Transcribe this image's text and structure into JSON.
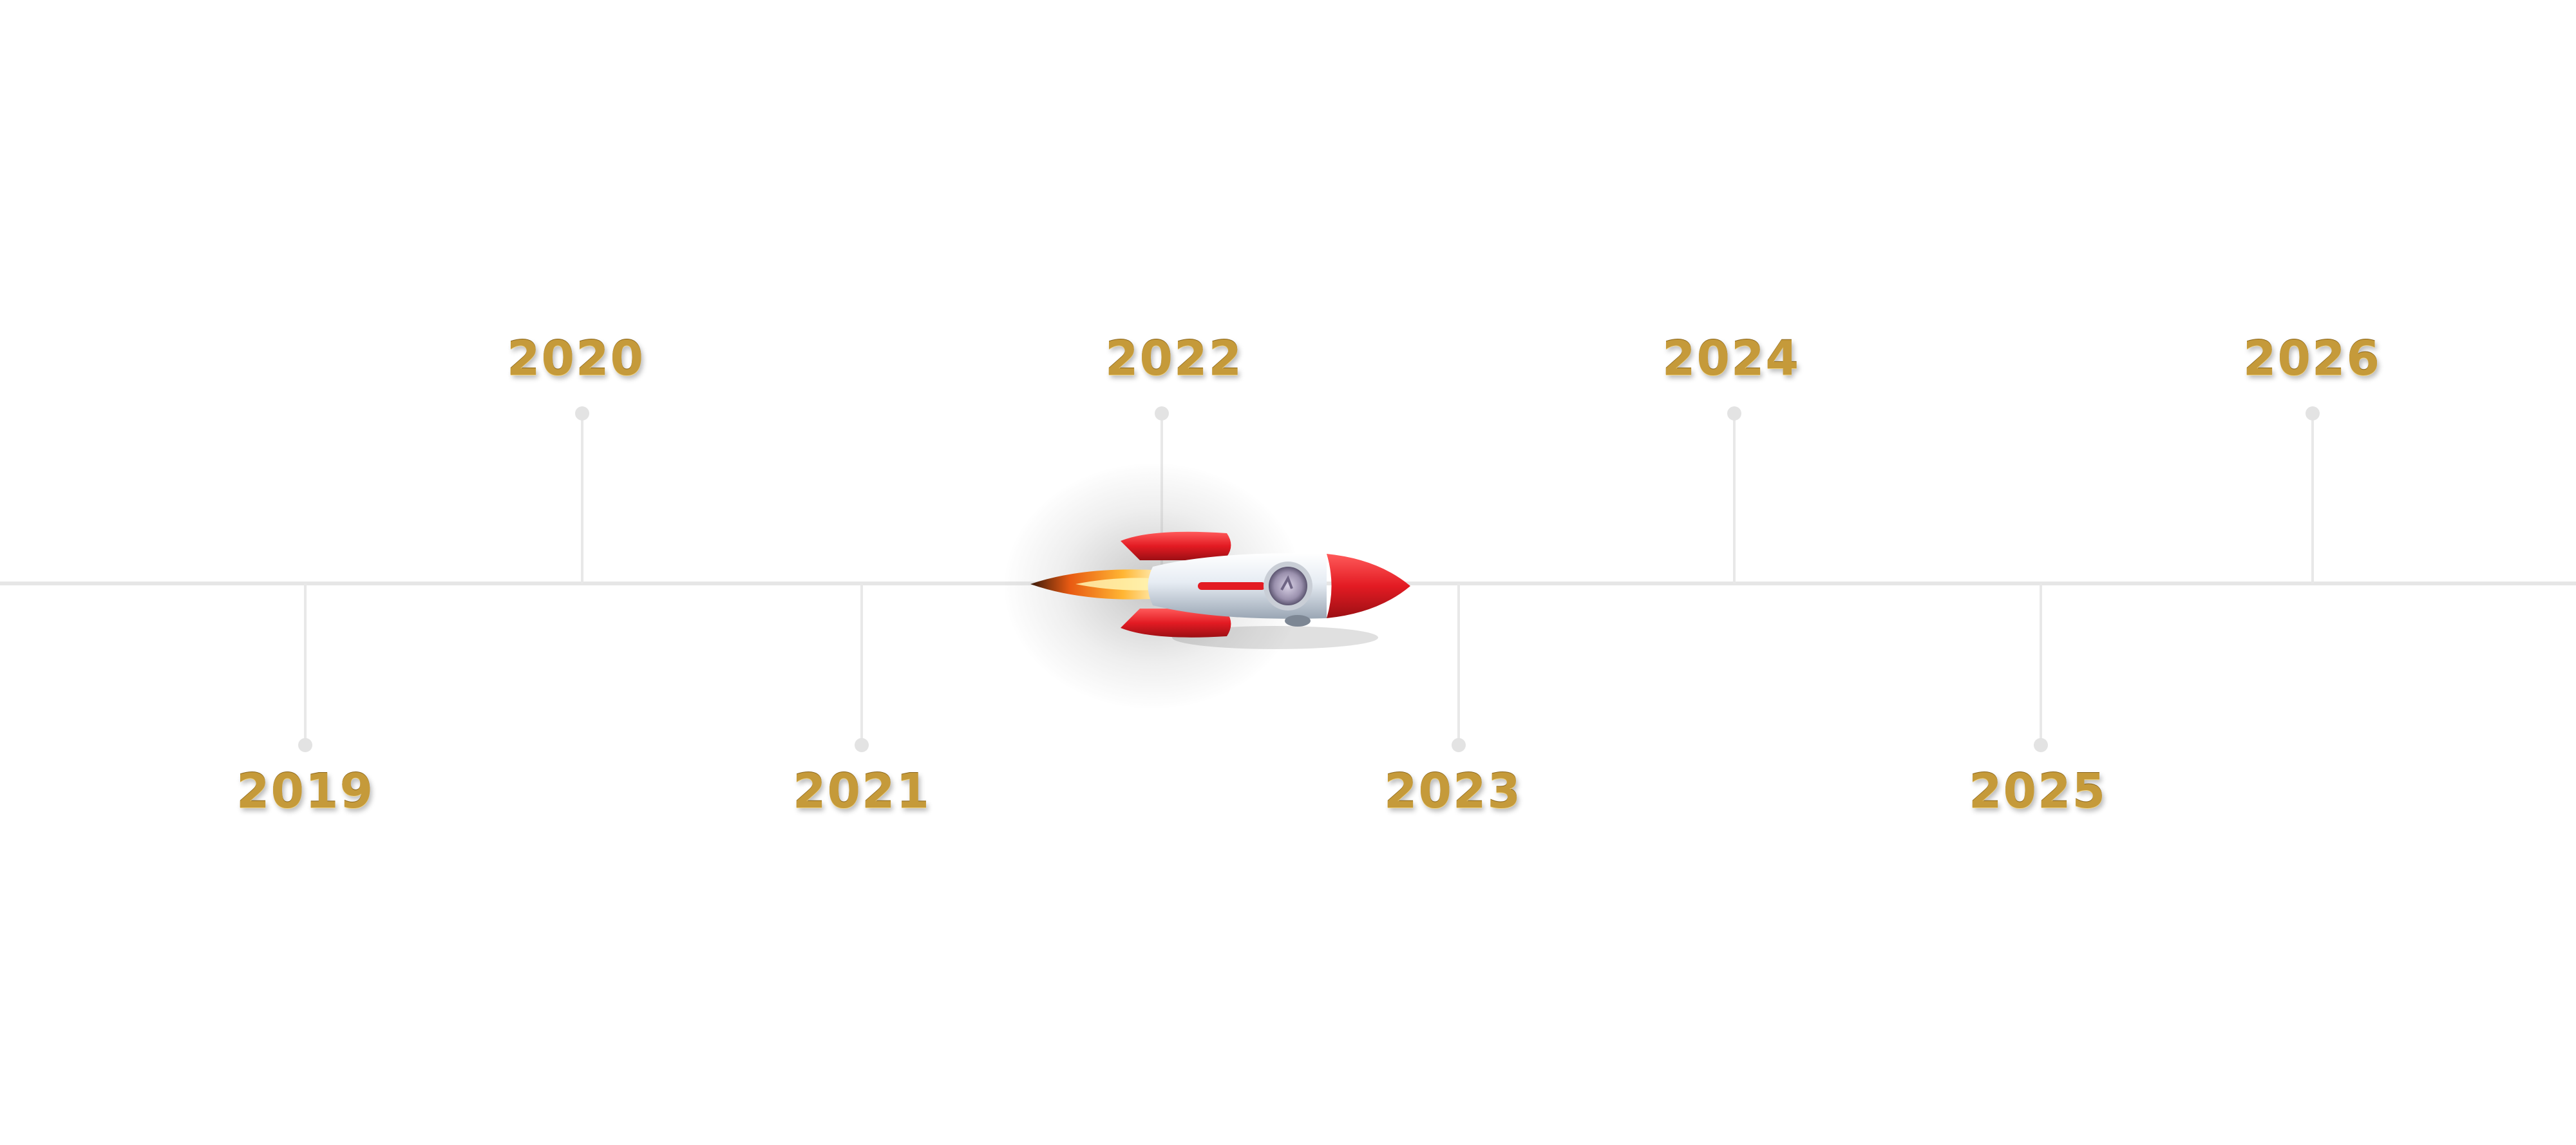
{
  "timeline": {
    "years_above": [
      {
        "label": "2020"
      },
      {
        "label": "2022"
      },
      {
        "label": "2024"
      },
      {
        "label": "2026"
      }
    ],
    "years_below": [
      {
        "label": "2019"
      },
      {
        "label": "2021"
      },
      {
        "label": "2023"
      },
      {
        "label": "2025"
      }
    ]
  },
  "colors": {
    "year_gold": "#c59a3a",
    "axis": "#e6e6e6",
    "rocket_red": "#e31b23",
    "rocket_body": "#dfe6ef"
  },
  "icons": {
    "marker": "rocket-icon"
  }
}
